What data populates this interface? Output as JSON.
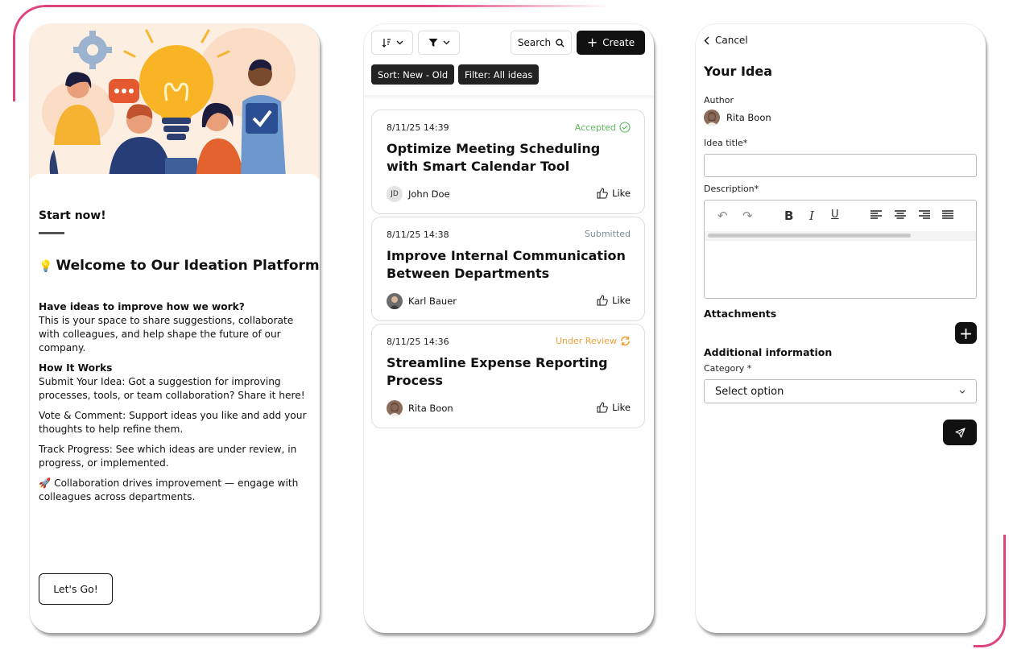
{
  "panel_start": {
    "start_now": "Start now!",
    "welcome_title": "Welcome to Our Ideation Platform!",
    "intro_heading": "Have ideas to improve how we work?",
    "intro_text": "This is your space to share suggestions, collaborate with colleagues, and help shape the future of our company.",
    "how_heading": "How It Works",
    "step_submit": "Submit Your Idea: Got a suggestion for improving processes, tools, or team collaboration? Share it here!",
    "step_vote": "Vote & Comment: Support ideas you like and add your thoughts to help refine them.",
    "step_track": "Track Progress: See which ideas are under review, in progress, or implemented.",
    "collab_text": "Collaboration drives improvement — engage with colleagues across departments.",
    "go_button": "Let's Go!"
  },
  "panel_list": {
    "toolbar": {
      "search_label": "Search",
      "create_label": "Create"
    },
    "chips": {
      "sort": "Sort: New - Old",
      "filter": "Filter: All ideas"
    },
    "ideas": [
      {
        "date": "8/11/25 14:39",
        "status": "Accepted",
        "status_color": "#5cb85c",
        "title": "Optimize Meeting Scheduling with Smart Calendar Tool",
        "author": "John Doe",
        "initials": "JD",
        "like": "Like"
      },
      {
        "date": "8/11/25 14:38",
        "status": "Submitted",
        "status_color": "#7a8a99",
        "title": "Improve Internal Communication Between Departments",
        "author": "Karl Bauer",
        "like": "Like"
      },
      {
        "date": "8/11/25 14:36",
        "status": "Under Review",
        "status_color": "#f0a23a",
        "title": "Streamline Expense Reporting Process",
        "author": "Rita Boon",
        "like": "Like"
      }
    ]
  },
  "panel_form": {
    "cancel": "Cancel",
    "heading": "Your Idea",
    "author_label": "Author",
    "author_name": "Rita Boon",
    "title_label": "Idea title*",
    "title_value": "",
    "description_label": "Description*",
    "attachments_heading": "Attachments",
    "additional_heading": "Additional information",
    "category_label": "Category *",
    "category_value": "Select option"
  }
}
